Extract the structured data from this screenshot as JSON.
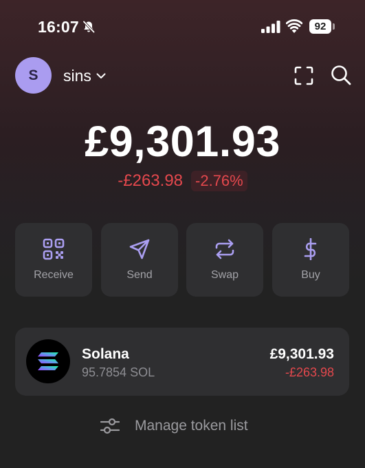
{
  "status_bar": {
    "time": "16:07",
    "battery": "92",
    "icons": [
      "bell-muted-icon",
      "signal-icon",
      "wifi-icon",
      "battery-icon"
    ]
  },
  "header": {
    "avatar_initial": "S",
    "account_name": "sins",
    "icons": [
      "chevron-down-icon",
      "scan-icon",
      "search-icon"
    ]
  },
  "balance": {
    "total": "£9,301.93",
    "change_amount": "-£263.98",
    "change_percent": "-2.76%"
  },
  "actions": [
    {
      "label": "Receive",
      "icon": "qr-code-icon"
    },
    {
      "label": "Send",
      "icon": "send-icon"
    },
    {
      "label": "Swap",
      "icon": "swap-icon"
    },
    {
      "label": "Buy",
      "icon": "dollar-icon"
    }
  ],
  "tokens": [
    {
      "name": "Solana",
      "amount": "95.7854 SOL",
      "value": "£9,301.93",
      "change": "-£263.98",
      "icon": "solana-logo-icon"
    }
  ],
  "manage": {
    "label": "Manage token list",
    "icon": "sliders-icon"
  },
  "colors": {
    "accent": "#ab9ff2",
    "negative": "#e5484d",
    "card": "#2f2f31",
    "muted_text": "#a3a3a8"
  }
}
